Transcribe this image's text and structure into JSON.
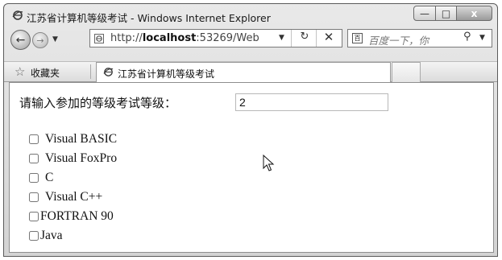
{
  "window": {
    "title": "江苏省计算机等级考试 - Windows Internet Explorer",
    "buttons": {
      "minimize": "—",
      "maximize": "□",
      "close": "x"
    }
  },
  "navigation": {
    "back_glyph": "←",
    "forward_glyph": "→",
    "address": {
      "prefix": "http://",
      "host": "localhost",
      "rest": ":53269/Web"
    },
    "refresh_glyph": "↻",
    "stop_glyph": "✕",
    "search": {
      "logo": "百",
      "placeholder": "百度一下，你",
      "button_glyph": "⚲"
    }
  },
  "favorites": {
    "label": "收藏夹"
  },
  "tab": {
    "label": "江苏省计算机等级考试"
  },
  "page": {
    "prompt_label": "请输入参加的等级考试等级：",
    "level_value": "2",
    "options": [
      {
        "label": "Visual BASIC",
        "checked": false
      },
      {
        "label": "Visual FoxPro",
        "checked": false
      },
      {
        "label": "C",
        "checked": false
      },
      {
        "label": "Visual C++",
        "checked": false
      },
      {
        "label": "FORTRAN 90",
        "checked": false
      },
      {
        "label": "Java",
        "checked": false
      }
    ]
  }
}
